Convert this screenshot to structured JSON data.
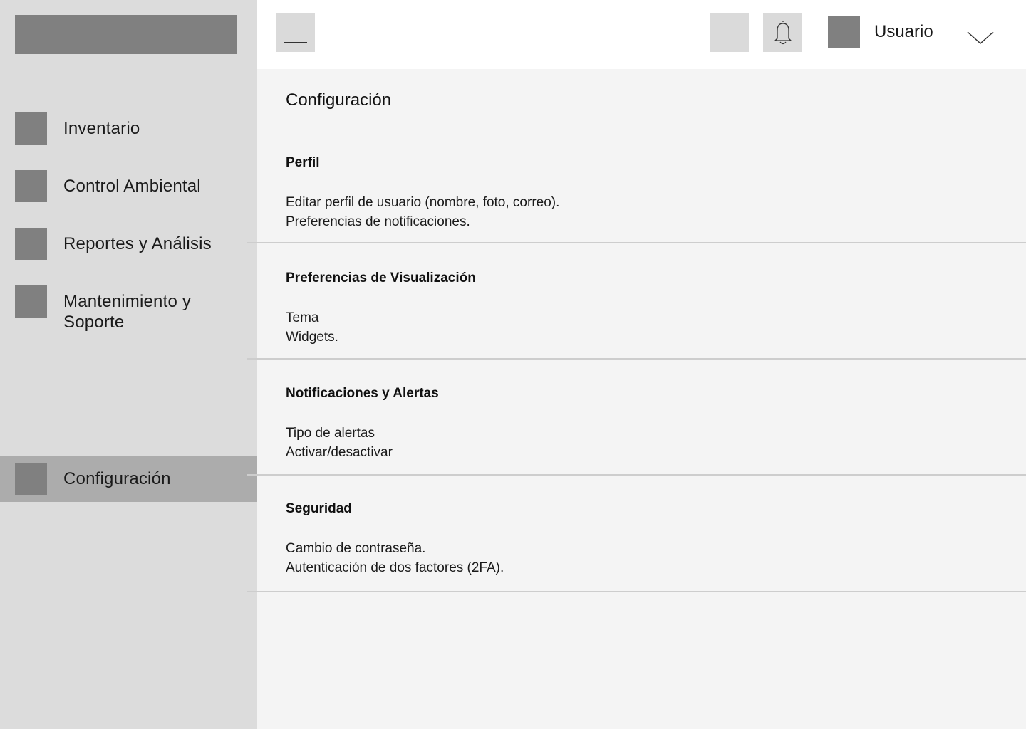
{
  "sidebar": {
    "items": [
      {
        "label": "Inventario",
        "active": false
      },
      {
        "label": "Control Ambiental",
        "active": false
      },
      {
        "label": "Reportes y Análisis",
        "active": false
      },
      {
        "label": "Mantenimiento y Soporte",
        "active": false
      },
      {
        "label": "Configuración",
        "active": true
      }
    ]
  },
  "header": {
    "user_name": "Usuario"
  },
  "main": {
    "title": "Configuración",
    "sections": [
      {
        "title": "Perfil",
        "lines": [
          "Editar perfil de usuario (nombre, foto, correo).",
          "Preferencias de notificaciones."
        ]
      },
      {
        "title": "Preferencias de Visualización",
        "lines": [
          "Tema",
          "Widgets."
        ]
      },
      {
        "title": "Notificaciones y Alertas",
        "lines": [
          "Tipo de alertas",
          "Activar/desactivar"
        ]
      },
      {
        "title": "Seguridad",
        "lines": [
          "Cambio de contraseña.",
          "Autenticación de dos factores (2FA)."
        ]
      }
    ]
  },
  "icons": {
    "menu": "hamburger-icon",
    "notifications": "bell-icon",
    "dropdown": "chevron-down-icon"
  },
  "colors": {
    "sidebar_bg": "#dcdcdc",
    "active_item_bg": "#acacac",
    "placeholder_gray": "#808080",
    "button_bg": "#dadada",
    "main_bg": "#f4f4f4",
    "divider": "#cdcdcd"
  }
}
